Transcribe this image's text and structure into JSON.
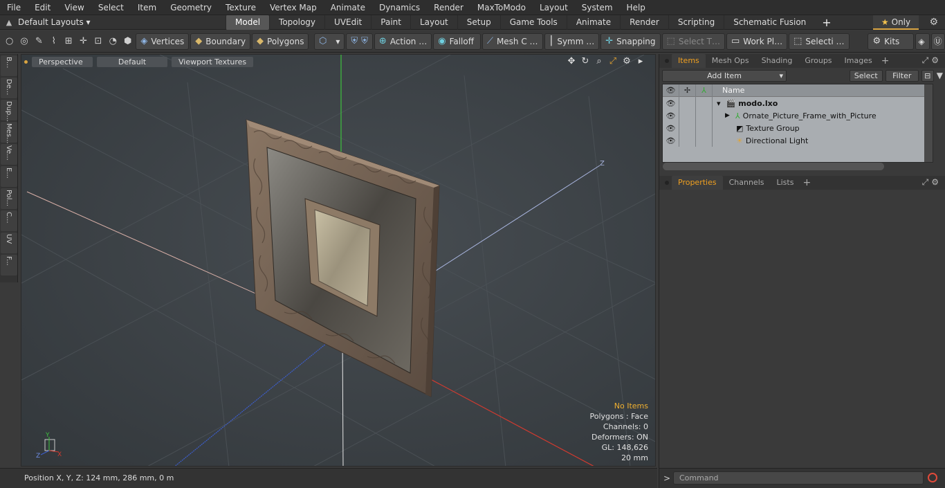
{
  "menu": [
    "File",
    "Edit",
    "View",
    "Select",
    "Item",
    "Geometry",
    "Texture",
    "Vertex Map",
    "Animate",
    "Dynamics",
    "Render",
    "MaxToModo",
    "Layout",
    "System",
    "Help"
  ],
  "layoutbar": {
    "layouts_label": "Default Layouts ▾",
    "tabs": [
      "Model",
      "Topology",
      "UVEdit",
      "Paint",
      "Layout",
      "Setup",
      "Game Tools",
      "Animate",
      "Render",
      "Scripting",
      "Schematic Fusion"
    ],
    "active_tab": "Model",
    "only_label": "Only"
  },
  "toolbar": {
    "vertices": "Vertices",
    "boundary": "Boundary",
    "polygons": "Polygons",
    "action": "Action …",
    "falloff": "Falloff",
    "meshc": "Mesh C …",
    "symm": "Symm …",
    "snapping": "Snapping",
    "selectt": "Select T…",
    "workpl": "Work Pl…",
    "selecti": "Selecti …",
    "kits": "Kits"
  },
  "lefttabs": [
    "B...",
    "De...",
    "Dup...",
    "Mes...",
    "Ve...",
    "E...",
    "Pol...",
    "C...",
    "UV",
    "F..."
  ],
  "viewport": {
    "perspective": "Perspective",
    "default": "Default",
    "textures": "Viewport Textures",
    "stats": {
      "no_items": "No Items",
      "polygons": "Polygons : Face",
      "channels": "Channels: 0",
      "deformers": "Deformers: ON",
      "gl": "GL: 148,626",
      "scale": "20 mm"
    },
    "axis_z_label": "Z"
  },
  "status": {
    "position": "Position X, Y, Z:   124 mm, 286 mm, 0 m"
  },
  "items_panel": {
    "tabs": [
      "Items",
      "Mesh Ops",
      "Shading",
      "Groups",
      "Images"
    ],
    "active": "Items",
    "add_item": "Add Item",
    "select": "Select",
    "filter": "Filter",
    "name_header": "Name",
    "rows": [
      {
        "name": "modo.lxo",
        "bold": true
      },
      {
        "name": "Ornate_Picture_Frame_with_Picture"
      },
      {
        "name": "Texture Group"
      },
      {
        "name": "Directional Light"
      }
    ]
  },
  "props_panel": {
    "tabs": [
      "Properties",
      "Channels",
      "Lists"
    ],
    "active": "Properties"
  },
  "command": {
    "placeholder": "Command"
  }
}
